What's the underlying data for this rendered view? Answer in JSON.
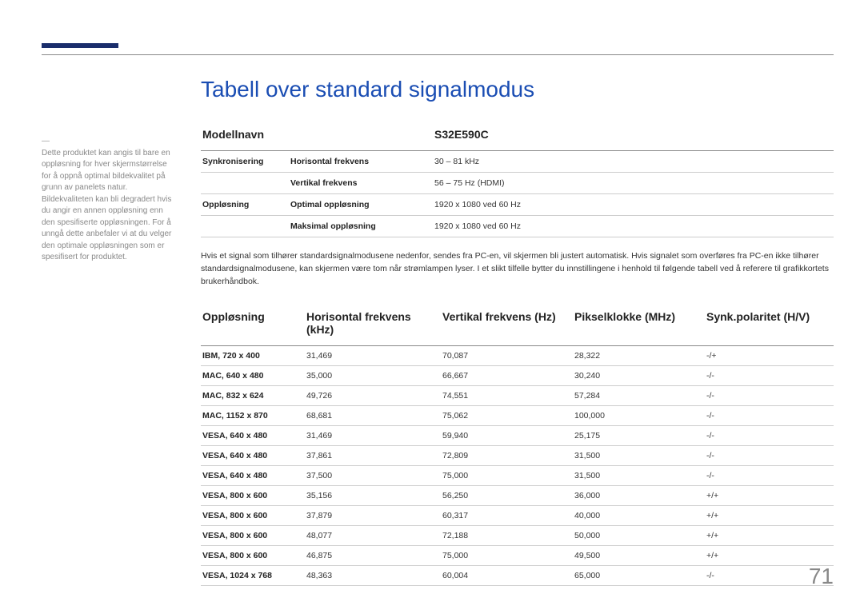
{
  "page": {
    "title": "Tabell over standard signalmodus",
    "number": "71"
  },
  "sidenote": {
    "dash": "―",
    "text": "Dette produktet kan angis til bare en oppløsning for hver skjermstørrelse for å oppnå optimal bildekvalitet på grunn av panelets natur. Bildekvaliteten kan bli degradert hvis du angir en annen oppløsning enn den spesifiserte oppløsningen. For å unngå dette anbefaler vi at du velger den optimale oppløsningen som er spesifisert for produktet."
  },
  "specTable": {
    "headers": {
      "modelLabel": "Modellnavn",
      "modelValue": "S32E590C"
    },
    "rows": [
      {
        "group": "Synkronisering",
        "label": "Horisontal frekvens",
        "value": "30 – 81 kHz"
      },
      {
        "group": "",
        "label": "Vertikal frekvens",
        "value": "56 – 75 Hz (HDMI)"
      },
      {
        "group": "Oppløsning",
        "label": "Optimal oppløsning",
        "value": "1920 x 1080 ved 60 Hz"
      },
      {
        "group": "",
        "label": "Maksimal oppløsning",
        "value": "1920 x 1080 ved 60 Hz"
      }
    ]
  },
  "paragraph": "Hvis et signal som tilhører standardsignalmodusene nedenfor, sendes fra PC-en, vil skjermen bli justert automatisk. Hvis signalet som overføres fra PC-en ikke tilhører standardsignalmodusene, kan skjermen være tom når strømlampen lyser. I et slikt tilfelle bytter du innstillingene i henhold til følgende tabell ved å referere til grafikkortets brukerhåndbok.",
  "signalTable": {
    "headers": {
      "resolution": "Oppløsning",
      "hfreq": "Horisontal frekvens (kHz)",
      "vfreq": "Vertikal frekvens (Hz)",
      "pixelclock": "Pikselklokke (MHz)",
      "sync": "Synk.polaritet (H/V)"
    },
    "rows": [
      {
        "res": "IBM, 720 x 400",
        "hf": "31,469",
        "vf": "70,087",
        "pc": "28,322",
        "sp": "-/+"
      },
      {
        "res": "MAC, 640 x 480",
        "hf": "35,000",
        "vf": "66,667",
        "pc": "30,240",
        "sp": "-/-"
      },
      {
        "res": "MAC, 832 x 624",
        "hf": "49,726",
        "vf": "74,551",
        "pc": "57,284",
        "sp": "-/-"
      },
      {
        "res": "MAC, 1152 x 870",
        "hf": "68,681",
        "vf": "75,062",
        "pc": "100,000",
        "sp": "-/-"
      },
      {
        "res": "VESA, 640 x 480",
        "hf": "31,469",
        "vf": "59,940",
        "pc": "25,175",
        "sp": "-/-"
      },
      {
        "res": "VESA, 640 x 480",
        "hf": "37,861",
        "vf": "72,809",
        "pc": "31,500",
        "sp": "-/-"
      },
      {
        "res": "VESA, 640 x 480",
        "hf": "37,500",
        "vf": "75,000",
        "pc": "31,500",
        "sp": "-/-"
      },
      {
        "res": "VESA, 800 x 600",
        "hf": "35,156",
        "vf": "56,250",
        "pc": "36,000",
        "sp": "+/+"
      },
      {
        "res": "VESA, 800 x 600",
        "hf": "37,879",
        "vf": "60,317",
        "pc": "40,000",
        "sp": "+/+"
      },
      {
        "res": "VESA, 800 x 600",
        "hf": "48,077",
        "vf": "72,188",
        "pc": "50,000",
        "sp": "+/+"
      },
      {
        "res": "VESA, 800 x 600",
        "hf": "46,875",
        "vf": "75,000",
        "pc": "49,500",
        "sp": "+/+"
      },
      {
        "res": "VESA, 1024 x 768",
        "hf": "48,363",
        "vf": "60,004",
        "pc": "65,000",
        "sp": "-/-"
      }
    ]
  }
}
